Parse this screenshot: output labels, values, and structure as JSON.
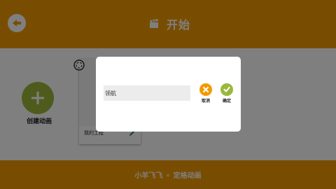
{
  "header": {
    "title": "开始",
    "accent": "#f39a02"
  },
  "create": {
    "label": "创建动画",
    "color": "#9ab83b"
  },
  "project": {
    "name": "我的工程"
  },
  "footer": {
    "text": "小羊飞飞 ⚬ 定格动画"
  },
  "dialog": {
    "input_value": "领航",
    "cancel_label": "取消",
    "confirm_label": "确定",
    "cancel_color": "#f39a02",
    "confirm_color": "#9ab83b"
  }
}
